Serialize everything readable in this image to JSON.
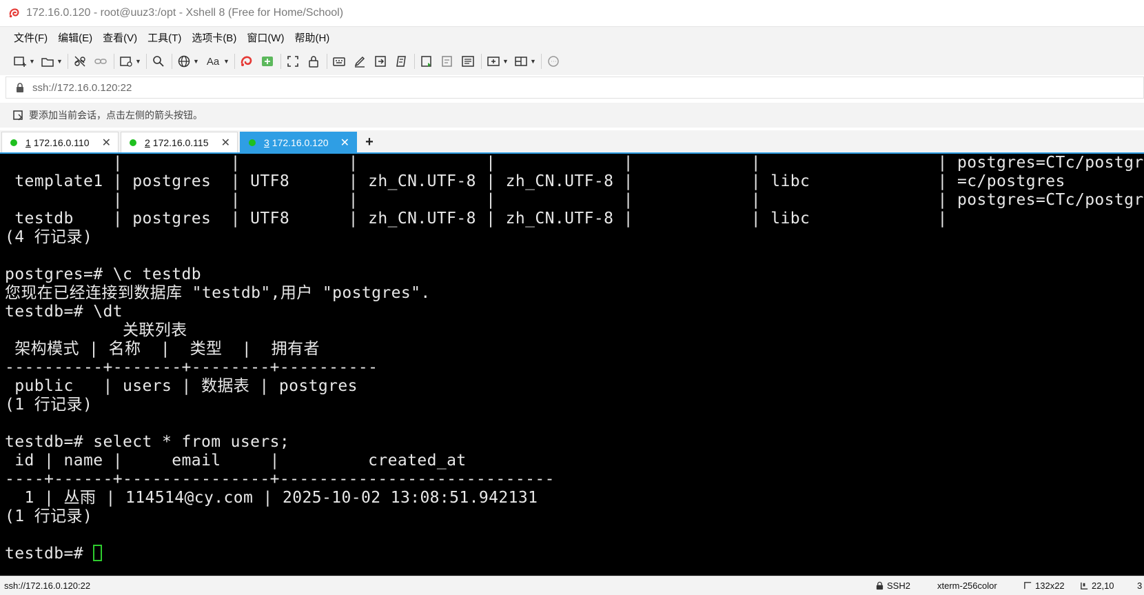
{
  "window": {
    "title": "172.16.0.120 - root@uuz3:/opt - Xshell 8 (Free for Home/School)"
  },
  "menu": [
    "文件(F)",
    "编辑(E)",
    "查看(V)",
    "工具(T)",
    "选项卡(B)",
    "窗口(W)",
    "帮助(H)"
  ],
  "toolbar": {
    "icons": [
      "new-session-icon",
      "open-folder-icon",
      "disconnect-icon",
      "reconnect-icon",
      "new-window-icon",
      "search-icon",
      "globe-icon",
      "font-icon",
      "xshell-logo-icon",
      "xftp-icon",
      "fullscreen-icon",
      "lock-icon",
      "keyboard-icon",
      "highlight-icon",
      "transfer-icon",
      "script-icon",
      "compose-icon",
      "compose-bar-icon",
      "notes-icon",
      "add-panel-icon",
      "layout-icon",
      "chat-icon"
    ],
    "font_label": "Aa"
  },
  "address": {
    "value": "ssh://172.16.0.120:22"
  },
  "hint": {
    "text": "要添加当前会话，点击左侧的箭头按钮。"
  },
  "tabs": [
    {
      "num": "1",
      "host": "172.16.0.110",
      "active": false
    },
    {
      "num": "2",
      "host": "172.16.0.115",
      "active": false
    },
    {
      "num": "3",
      "host": "172.16.0.120",
      "active": true
    }
  ],
  "terminal": {
    "lines": [
      "           |           |           |             |             |            |                  | postgres=CTc/postgres",
      " template1 | postgres  | UTF8      | zh_CN.UTF-8 | zh_CN.UTF-8 |            | libc             | =c/postgres          +",
      "           |           |           |             |             |            |                  | postgres=CTc/postgres",
      " testdb    | postgres  | UTF8      | zh_CN.UTF-8 | zh_CN.UTF-8 |            | libc             |",
      "(4 行记录)",
      "",
      "postgres=# \\c testdb",
      "您现在已经连接到数据库 \"testdb\",用户 \"postgres\".",
      "testdb=# \\dt",
      "            关联列表",
      " 架构模式 | 名称  |  类型  |  拥有者",
      "----------+-------+--------+----------",
      " public   | users | 数据表 | postgres",
      "(1 行记录)",
      "",
      "testdb=# select * from users;",
      " id | name |     email     |         created_at",
      "----+------+---------------+----------------------------",
      "  1 | 丛雨 | 114514@cy.com | 2025-10-02 13:08:51.942131",
      "(1 行记录)",
      "",
      "testdb=# "
    ]
  },
  "status": {
    "connection": "ssh://172.16.0.120:22",
    "protocol": "SSH2",
    "term_type": "xterm-256color",
    "size": "132x22",
    "cursor_pos": "22,10",
    "extra": "3"
  }
}
